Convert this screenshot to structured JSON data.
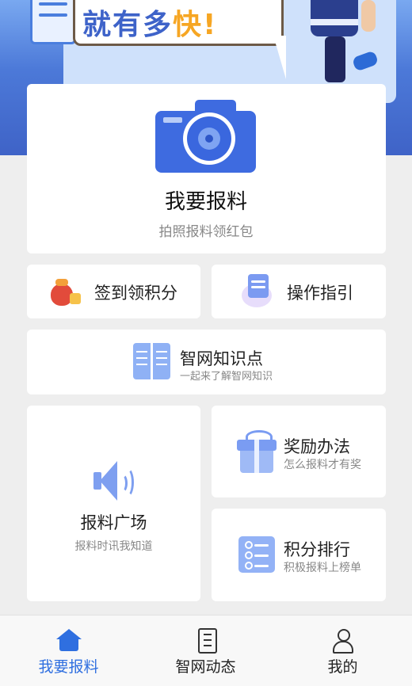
{
  "banner": {
    "slogan_prefix": "就有多",
    "slogan_highlight": "快",
    "slogan_suffix": "!"
  },
  "report_main": {
    "icon": "camera-icon",
    "title": "我要报料",
    "subtitle": "拍照报料领红包"
  },
  "checkin": {
    "icon": "red-envelope-icon",
    "label": "签到领积分"
  },
  "guide": {
    "icon": "guide-book-icon",
    "label": "操作指引"
  },
  "knowledge": {
    "icon": "open-book-icon",
    "title": "智网知识点",
    "subtitle": "一起来了解智网知识"
  },
  "square": {
    "icon": "speaker-icon",
    "title": "报料广场",
    "subtitle": "报料时讯我知道"
  },
  "reward": {
    "icon": "gift-icon",
    "title": "奖励办法",
    "subtitle": "怎么报料才有奖"
  },
  "rank": {
    "icon": "list-icon",
    "title": "积分排行",
    "subtitle": "积极报料上榜单"
  },
  "tabbar": {
    "active_color": "#2f6fe0",
    "tabs": [
      {
        "icon": "home-icon",
        "label": "我要报料",
        "active": true
      },
      {
        "icon": "news-icon",
        "label": "智网动态",
        "active": false
      },
      {
        "icon": "user-icon",
        "label": "我的",
        "active": false
      }
    ]
  }
}
